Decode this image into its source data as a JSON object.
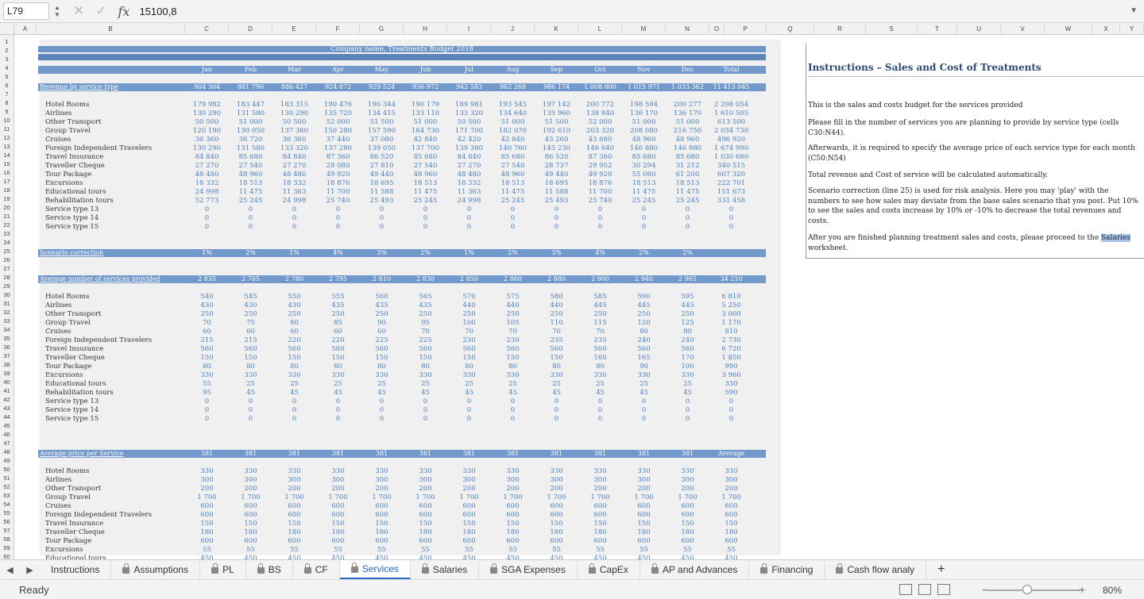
{
  "formula_bar": {
    "cell_ref": "L79",
    "fx_label": "fx",
    "value": "15100,8"
  },
  "columns": [
    "A",
    "B",
    "C",
    "D",
    "E",
    "F",
    "G",
    "H",
    "I",
    "J",
    "K",
    "L",
    "M",
    "N",
    "O",
    "P",
    "Q",
    "R",
    "S",
    "T",
    "U",
    "V",
    "W",
    "X",
    "Y"
  ],
  "rows": [
    "1",
    "2",
    "3",
    "4",
    "5",
    "6",
    "7",
    "8",
    "9",
    "10",
    "11",
    "12",
    "13",
    "14",
    "15",
    "16",
    "17",
    "18",
    "19",
    "20",
    "21",
    "22",
    "23",
    "24",
    "25",
    "26",
    "27",
    "28",
    "29",
    "30",
    "31",
    "32",
    "33",
    "34",
    "35",
    "36",
    "37",
    "38",
    "39",
    "40",
    "41",
    "42",
    "43",
    "44",
    "45",
    "46",
    "47",
    "48",
    "49",
    "50",
    "51",
    "52",
    "53",
    "54",
    "55",
    "56",
    "57",
    "58",
    "59",
    "60"
  ],
  "sheet": {
    "title": "Company name, Treatments Budget 2018",
    "months": [
      "Jan",
      "Feb",
      "Mar",
      "Apr",
      "May",
      "Jun",
      "Jul",
      "Aug",
      "Sep",
      "Oct",
      "Nov",
      "Dec",
      "Total"
    ],
    "revenue_label": "Revenue by service type",
    "revenue_totals": [
      "904 304",
      "881 790",
      "886 427",
      "924 872",
      "929 524",
      "936 972",
      "942 583",
      "962 268",
      "986 174",
      "1 008 800",
      "1 015 971",
      "1 033 362",
      "11 413 045"
    ],
    "service_names": [
      "Hotel Rooms",
      "Airlines",
      "Other Transport",
      "Group Travel",
      "Cruises",
      "Foreign Independent Travelers",
      "Travel Insurance",
      "Traveller Cheque",
      "Tour Package",
      "Excursions",
      "Educational tours",
      "Rehabilitation tours",
      "Service type 13",
      "Service type 14",
      "Service type 15"
    ],
    "revenue_rows": [
      [
        "179 982",
        "183 447",
        "183 315",
        "190 476",
        "190 344",
        "190 179",
        "189 981",
        "193 545",
        "197 142",
        "200 772",
        "198 594",
        "200 277",
        "2 298 054"
      ],
      [
        "130 290",
        "131 580",
        "130 290",
        "135 720",
        "134 415",
        "133 110",
        "133 320",
        "134 640",
        "135 960",
        "138 840",
        "136 170",
        "136 170",
        "1 610 505"
      ],
      [
        "50 500",
        "51 000",
        "50 500",
        "52 000",
        "51 500",
        "51 000",
        "50 500",
        "51 000",
        "51 500",
        "52 000",
        "51 000",
        "51 000",
        "613 500"
      ],
      [
        "120 190",
        "130 050",
        "137 360",
        "150 280",
        "157 590",
        "164 730",
        "171 700",
        "182 070",
        "192 610",
        "203 320",
        "208 080",
        "216 750",
        "2 034 730"
      ],
      [
        "36 360",
        "36 720",
        "36 360",
        "37 440",
        "37 080",
        "42 840",
        "42 420",
        "42 840",
        "43 260",
        "43 680",
        "48 960",
        "48 960",
        "496 920"
      ],
      [
        "130 290",
        "131 580",
        "133 320",
        "137 280",
        "139 050",
        "137 700",
        "139 380",
        "140 760",
        "145 230",
        "146 640",
        "146 880",
        "146 880",
        "1 674 990"
      ],
      [
        "84 840",
        "85 680",
        "84 840",
        "87 360",
        "86 520",
        "85 680",
        "84 840",
        "85 680",
        "86 520",
        "87 360",
        "85 680",
        "85 680",
        "1 030 680"
      ],
      [
        "27 270",
        "27 540",
        "27 270",
        "28 080",
        "27 810",
        "27 540",
        "27 270",
        "27 540",
        "28 737",
        "29 952",
        "30 294",
        "31 212",
        "340 515"
      ],
      [
        "48 480",
        "48 960",
        "48 480",
        "49 920",
        "49 440",
        "48 960",
        "48 480",
        "48 960",
        "49 440",
        "49 920",
        "55 080",
        "61 200",
        "607 320"
      ],
      [
        "18 332",
        "18 513",
        "18 332",
        "18 876",
        "18 695",
        "18 513",
        "18 332",
        "18 513",
        "18 695",
        "18 876",
        "18 513",
        "18 513",
        "222 701"
      ],
      [
        "24 998",
        "11 475",
        "11 363",
        "11 700",
        "11 588",
        "11 475",
        "11 363",
        "11 475",
        "11 588",
        "11 700",
        "11 475",
        "11 475",
        "151 673"
      ],
      [
        "52 773",
        "25 245",
        "24 998",
        "25 740",
        "25 493",
        "25 245",
        "24 998",
        "25 245",
        "25 493",
        "25 740",
        "25 245",
        "25 245",
        "331 458"
      ],
      [
        "0",
        "0",
        "0",
        "0",
        "0",
        "0",
        "0",
        "0",
        "0",
        "0",
        "0",
        "0",
        "0"
      ],
      [
        "0",
        "0",
        "0",
        "0",
        "0",
        "0",
        "0",
        "0",
        "0",
        "0",
        "0",
        "0",
        "0"
      ],
      [
        "0",
        "0",
        "0",
        "0",
        "0",
        "0",
        "0",
        "0",
        "0",
        "0",
        "0",
        "0",
        "0"
      ]
    ],
    "scenario_label": "Scenario correction",
    "scenario_values": [
      "1%",
      "2%",
      "1%",
      "4%",
      "3%",
      "2%",
      "1%",
      "2%",
      "3%",
      "4%",
      "2%",
      "2%"
    ],
    "avg_services_label": "Average number of services provided",
    "avg_services_totals": [
      "2 835",
      "2 765",
      "2 780",
      "2 795",
      "2 810",
      "2 830",
      "2 850",
      "2 860",
      "2 880",
      "2 900",
      "2 940",
      "2 965",
      "34 210"
    ],
    "services_rows": [
      [
        "540",
        "545",
        "550",
        "555",
        "560",
        "565",
        "570",
        "575",
        "580",
        "585",
        "590",
        "595",
        "6 810"
      ],
      [
        "430",
        "430",
        "430",
        "435",
        "435",
        "435",
        "440",
        "440",
        "440",
        "445",
        "445",
        "445",
        "5 250"
      ],
      [
        "250",
        "250",
        "250",
        "250",
        "250",
        "250",
        "250",
        "250",
        "250",
        "250",
        "250",
        "250",
        "3 000"
      ],
      [
        "70",
        "75",
        "80",
        "85",
        "90",
        "95",
        "100",
        "105",
        "110",
        "115",
        "120",
        "125",
        "1 170"
      ],
      [
        "60",
        "60",
        "60",
        "60",
        "60",
        "70",
        "70",
        "70",
        "70",
        "70",
        "80",
        "80",
        "810"
      ],
      [
        "215",
        "215",
        "220",
        "220",
        "225",
        "225",
        "230",
        "230",
        "235",
        "235",
        "240",
        "240",
        "2 730"
      ],
      [
        "560",
        "560",
        "560",
        "560",
        "560",
        "560",
        "560",
        "560",
        "560",
        "560",
        "560",
        "560",
        "6 720"
      ],
      [
        "150",
        "150",
        "150",
        "150",
        "150",
        "150",
        "150",
        "150",
        "150",
        "160",
        "165",
        "170",
        "1 850"
      ],
      [
        "80",
        "80",
        "80",
        "80",
        "80",
        "80",
        "80",
        "80",
        "80",
        "80",
        "90",
        "100",
        "990"
      ],
      [
        "330",
        "330",
        "330",
        "330",
        "330",
        "330",
        "330",
        "330",
        "330",
        "330",
        "330",
        "330",
        "3 960"
      ],
      [
        "55",
        "25",
        "25",
        "25",
        "25",
        "25",
        "25",
        "25",
        "25",
        "25",
        "25",
        "25",
        "330"
      ],
      [
        "95",
        "45",
        "45",
        "45",
        "45",
        "45",
        "45",
        "45",
        "45",
        "45",
        "45",
        "45",
        "590"
      ],
      [
        "0",
        "0",
        "0",
        "0",
        "0",
        "0",
        "0",
        "0",
        "0",
        "0",
        "0",
        "0",
        "0"
      ],
      [
        "0",
        "0",
        "0",
        "0",
        "0",
        "0",
        "0",
        "0",
        "0",
        "0",
        "0",
        "0",
        "0"
      ],
      [
        "0",
        "0",
        "0",
        "0",
        "0",
        "0",
        "0",
        "0",
        "0",
        "0",
        "0",
        "0",
        "0"
      ]
    ],
    "avg_price_label": "Average price per Service",
    "avg_price_totals": [
      "381",
      "381",
      "381",
      "381",
      "381",
      "381",
      "381",
      "381",
      "381",
      "381",
      "381",
      "381",
      "Average"
    ],
    "price_rows": [
      [
        "330",
        "330",
        "330",
        "330",
        "330",
        "330",
        "330",
        "330",
        "330",
        "330",
        "330",
        "330",
        "330"
      ],
      [
        "300",
        "300",
        "300",
        "300",
        "300",
        "300",
        "300",
        "300",
        "300",
        "300",
        "300",
        "300",
        "300"
      ],
      [
        "200",
        "200",
        "200",
        "200",
        "200",
        "200",
        "200",
        "200",
        "200",
        "200",
        "200",
        "200",
        "200"
      ],
      [
        "1 700",
        "1 700",
        "1 700",
        "1 700",
        "1 700",
        "1 700",
        "1 700",
        "1 700",
        "1 700",
        "1 700",
        "1 700",
        "1 700",
        "1 700"
      ],
      [
        "600",
        "600",
        "600",
        "600",
        "600",
        "600",
        "600",
        "600",
        "600",
        "600",
        "600",
        "600",
        "600"
      ],
      [
        "600",
        "600",
        "600",
        "600",
        "600",
        "600",
        "600",
        "600",
        "600",
        "600",
        "600",
        "600",
        "600"
      ],
      [
        "150",
        "150",
        "150",
        "150",
        "150",
        "150",
        "150",
        "150",
        "150",
        "150",
        "150",
        "150",
        "150"
      ],
      [
        "180",
        "180",
        "180",
        "180",
        "180",
        "180",
        "180",
        "180",
        "180",
        "180",
        "180",
        "180",
        "180"
      ],
      [
        "600",
        "600",
        "600",
        "600",
        "600",
        "600",
        "600",
        "600",
        "600",
        "600",
        "600",
        "600",
        "600"
      ],
      [
        "55",
        "55",
        "55",
        "55",
        "55",
        "55",
        "55",
        "55",
        "55",
        "55",
        "55",
        "55",
        "55"
      ],
      [
        "450",
        "450",
        "450",
        "450",
        "450",
        "450",
        "450",
        "450",
        "450",
        "450",
        "450",
        "450",
        "450"
      ]
    ]
  },
  "instructions": {
    "title": "Instructions – Sales and Cost of Treatments",
    "p1": "This is the sales and costs budget for the services provided",
    "p2": "Please fill in the number of services you are planning to provide by service type (cells C30:N44).",
    "p3": "Afterwards, it is required to specify the average price of each service type for each month (C50:N54)",
    "p4": "Total revenue and Cost of service will be calculated automatically.",
    "p5": "Scenario correction (line 25) is used for risk analysis. Here you may 'play' with the numbers to see how sales may deviate from the base sales scenario that you post. Put 10% to see the sales and costs increase by 10% or -10% to decrease the total revenues and costs.",
    "p6_pre": "After you are finished planning treatment sales and costs, please proceed to the ",
    "p6_hl": "Salaries",
    "p6_post": " worksheet."
  },
  "tabs": [
    {
      "label": "Instructions",
      "locked": false
    },
    {
      "label": "Assumptions",
      "locked": true
    },
    {
      "label": "PL",
      "locked": true
    },
    {
      "label": "BS",
      "locked": true
    },
    {
      "label": "CF",
      "locked": true
    },
    {
      "label": "Services",
      "locked": true,
      "active": true
    },
    {
      "label": "Salaries",
      "locked": true
    },
    {
      "label": "SGA Expenses",
      "locked": true
    },
    {
      "label": "CapEx",
      "locked": true
    },
    {
      "label": "AP and Advances",
      "locked": true
    },
    {
      "label": "Financing",
      "locked": true
    },
    {
      "label": "Cash flow analy",
      "locked": true
    }
  ],
  "add_sheet": "+",
  "status": {
    "ready": "Ready",
    "zoom": "80%",
    "zoom_minus": "−",
    "zoom_plus": "+"
  }
}
